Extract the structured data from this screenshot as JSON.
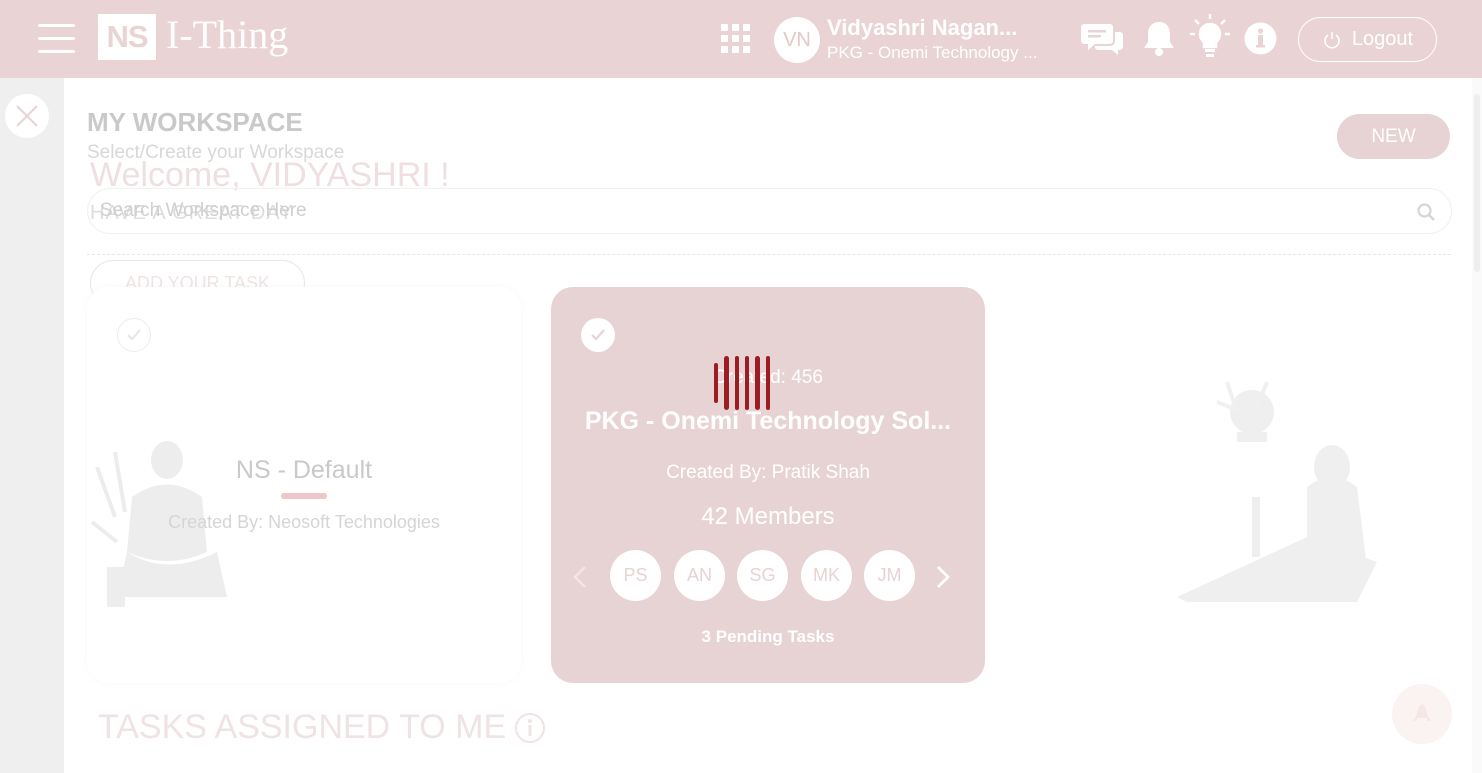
{
  "header": {
    "logo_mark": "NS",
    "logo_text": "I-Thing",
    "user_initials": "VN",
    "user_name": "Vidyashri Nagan...",
    "user_org": "PKG - Onemi Technology ...",
    "logout_label": "Logout"
  },
  "background": {
    "welcome": "Welcome, VIDYASHRI !",
    "greeting": "HAVE A GREAT DAY",
    "add_task_label": "ADD YOUR TASK",
    "tasks_heading": "TASKS ASSIGNED TO ME"
  },
  "workspace": {
    "title": "MY WORKSPACE",
    "subtitle": "Select/Create your Workspace",
    "new_label": "NEW",
    "search_placeholder": "Search Workspace Here"
  },
  "cards": [
    {
      "name": "NS - Default",
      "created_by": "Created By: Neosoft Technologies",
      "selected": false
    },
    {
      "created_id": "Created: 456",
      "name": "PKG - Onemi Technology Sol...",
      "created_by": "Created By: Pratik Shah",
      "members_count": "42 Members",
      "members": [
        "PS",
        "AN",
        "SG",
        "MK",
        "JM"
      ],
      "pending": "3 Pending Tasks",
      "selected": true
    }
  ],
  "colors": {
    "header_bg": "#e9d3d4",
    "card_active_bg": "#e8d3d4",
    "loader": "#9c1c23"
  }
}
